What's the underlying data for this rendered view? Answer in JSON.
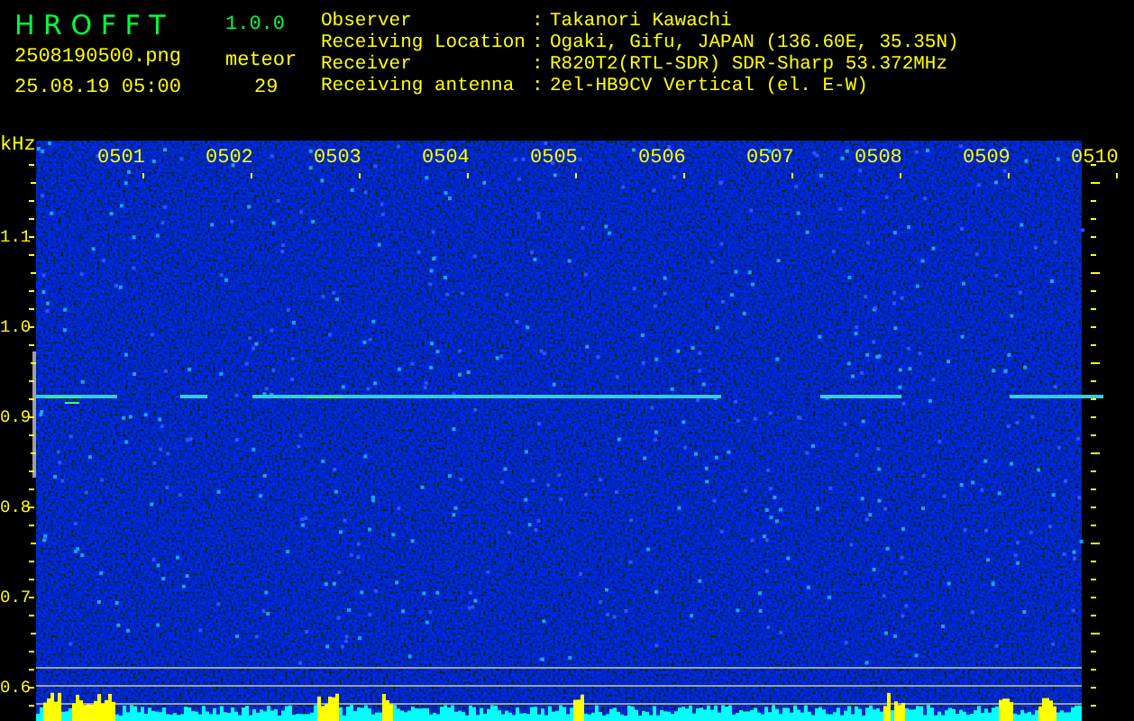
{
  "header": {
    "title": "H R O F F T",
    "version": "1.0.0",
    "filename": "2508190500.png",
    "detection_label": "meteor",
    "datetime": "25.08.19 05:00",
    "count": "29"
  },
  "station": [
    {
      "label": "Observer",
      "separator": ":",
      "value": "Takanori Kawachi"
    },
    {
      "label": "Receiving Location",
      "separator": ":",
      "value": "Ogaki, Gifu, JAPAN (136.60E, 35.35N)"
    },
    {
      "label": "Receiver",
      "separator": ":",
      "value": "R820T2(RTL-SDR) SDR-Sharp 53.372MHz"
    },
    {
      "label": "Receiving antenna",
      "separator": ":",
      "value": "2el-HB9CV Vertical (el. E-W)"
    }
  ],
  "plot": {
    "y_unit": "kHz",
    "y_labels": [
      "1.1",
      "1.0",
      "0.9",
      "0.8",
      "0.7",
      "0.6"
    ],
    "time_labels": [
      "0501",
      "0502",
      "0503",
      "0504",
      "0505",
      "0506",
      "0507",
      "0508",
      "0509",
      "0510"
    ]
  }
}
